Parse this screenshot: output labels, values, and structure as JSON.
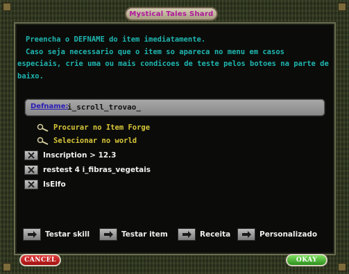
{
  "window": {
    "title": "Mystical Tales Shard"
  },
  "instructions": {
    "line1": "Preencha o DEFNAME do item imediatamente.",
    "line2": "Caso seja necessario que o item so apareca no menu em casos",
    "line3": "especiais, crie uma ou mais condicoes de teste pelos botoes na parte de",
    "line4": "baixo."
  },
  "defname": {
    "label": "Defname:",
    "value": "i_scroll_trovao_"
  },
  "finders": [
    {
      "label": "Procurar no Item Forge",
      "icon": "magnifier-icon"
    },
    {
      "label": "Selecionar no world",
      "icon": "magnifier-icon"
    }
  ],
  "conditions": [
    {
      "label": "Inscription > 12.3"
    },
    {
      "label": "restest 4 i_fibras_vegetais"
    },
    {
      "label": "IsElfo"
    }
  ],
  "test_buttons": [
    {
      "label": "Testar skill"
    },
    {
      "label": "Testar item"
    },
    {
      "label": "Receita"
    },
    {
      "label": "Personalizado"
    }
  ],
  "footer": {
    "cancel_label": "CANCEL",
    "okay_label": "OKAY"
  },
  "colors": {
    "title_text": "#b0169a",
    "instruction_text": "#1fb5b0",
    "finder_text": "#d9c63a",
    "defname_label": "#2b1db8"
  }
}
